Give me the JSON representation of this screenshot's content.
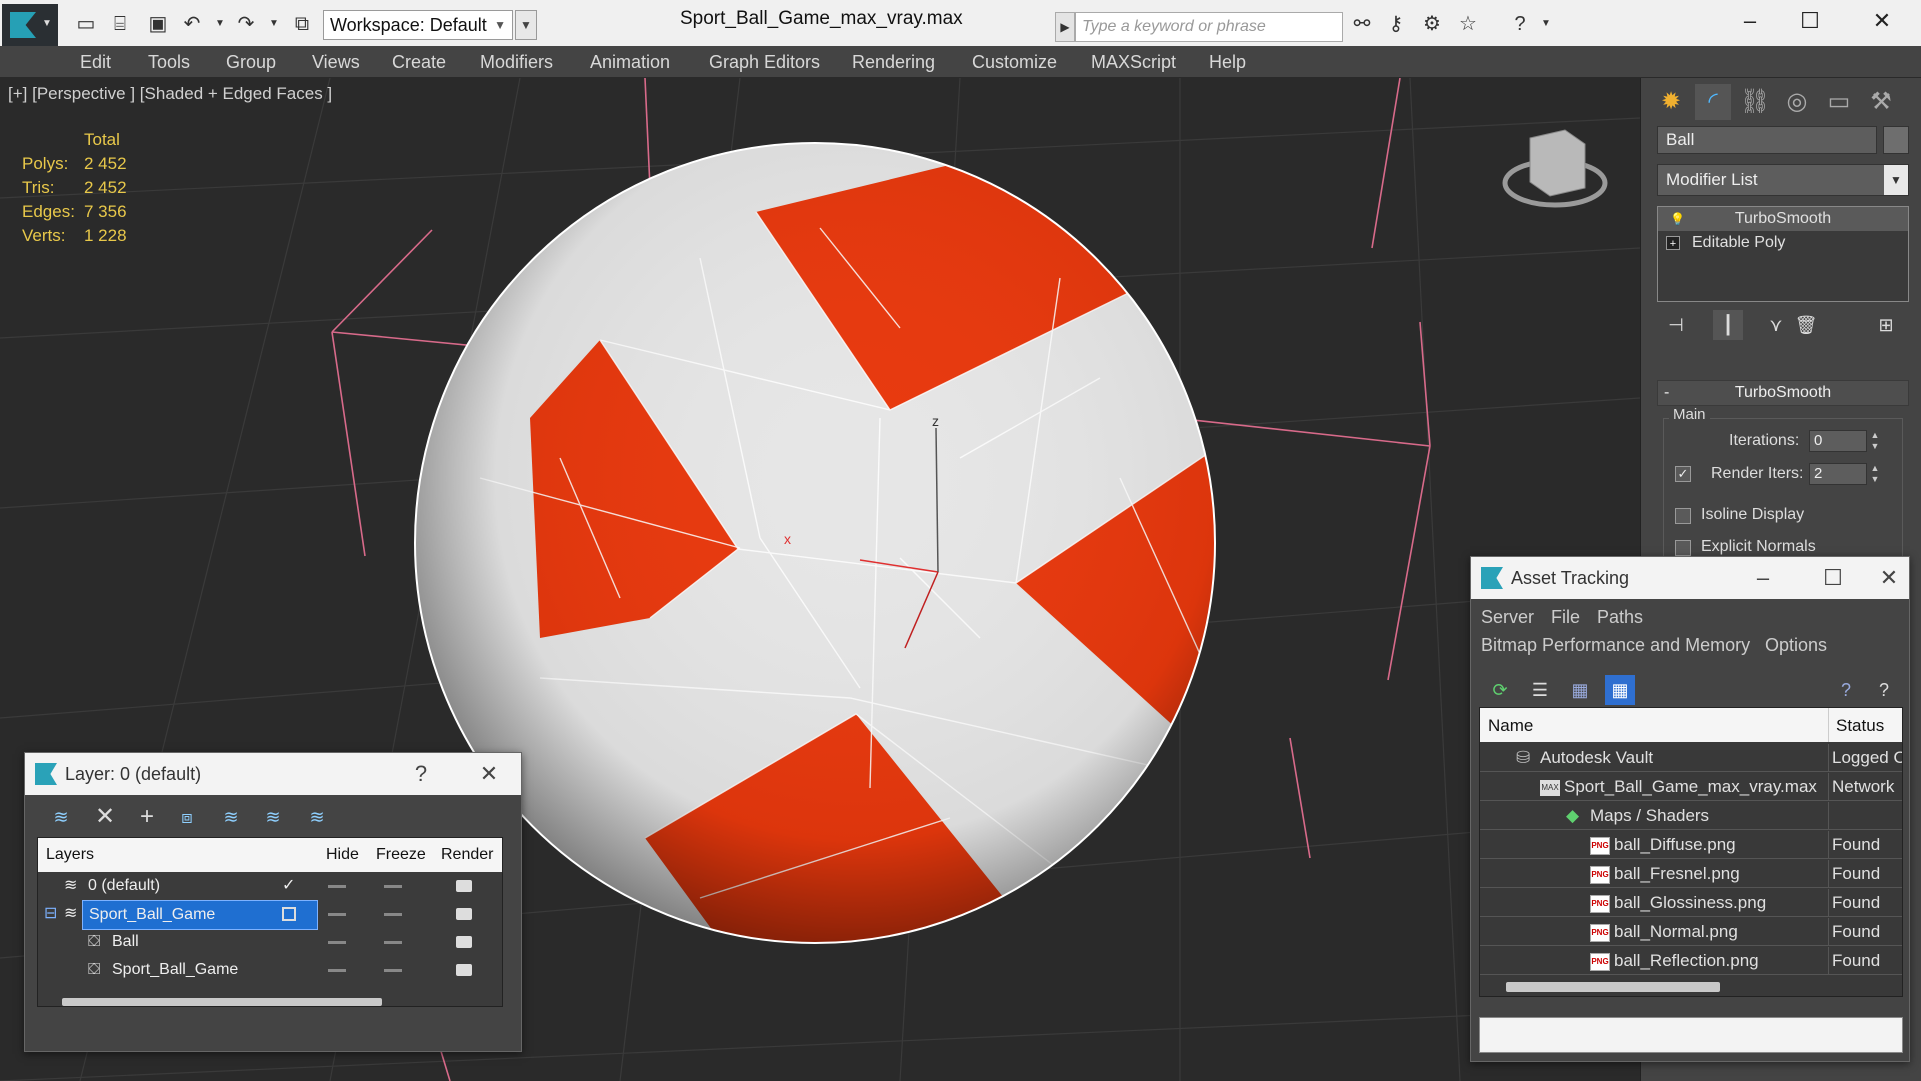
{
  "window": {
    "file_title": "Sport_Ball_Game_max_vray.max",
    "workspace_label": "Workspace: Default",
    "search_placeholder": "Type a keyword or phrase"
  },
  "menu": [
    "Edit",
    "Tools",
    "Group",
    "Views",
    "Create",
    "Modifiers",
    "Animation",
    "Graph Editors",
    "Rendering",
    "Customize",
    "MAXScript",
    "Help"
  ],
  "viewport": {
    "label": "[+] [Perspective ] [Shaded + Edged Faces ]",
    "stats_header": "Total",
    "stats": [
      {
        "label": "Polys:",
        "value": "2 452"
      },
      {
        "label": "Tris:",
        "value": "2 452"
      },
      {
        "label": "Edges:",
        "value": "7 356"
      },
      {
        "label": "Verts:",
        "value": "1 228"
      }
    ],
    "axis_x": "x",
    "axis_z": "z",
    "colors": {
      "ball_red": "#e8380d",
      "ball_white": "#e6e6e6",
      "grid_pink": "#d86a8a"
    }
  },
  "command_panel": {
    "object_name": "Ball",
    "modifier_list": "Modifier List",
    "stack": [
      "TurboSmooth",
      "Editable Poly"
    ],
    "rollout_title": "TurboSmooth",
    "group_main": "Main",
    "iterations_label": "Iterations:",
    "iterations_value": "0",
    "render_iters_label": "Render Iters:",
    "render_iters_value": "2",
    "render_iters_checked": "✓",
    "isoline_label": "Isoline Display",
    "explicit_normals_label": "Explicit Normals"
  },
  "layer_window": {
    "title": "Layer: 0 (default)",
    "help": "?",
    "close": "✕",
    "columns": {
      "layers": "Layers",
      "hide": "Hide",
      "freeze": "Freeze",
      "render": "Render"
    },
    "rows": [
      {
        "name": "0 (default)",
        "check": "✓"
      },
      {
        "name": "Sport_Ball_Game"
      },
      {
        "name": "Ball"
      },
      {
        "name": "Sport_Ball_Game"
      }
    ]
  },
  "asset_window": {
    "title": "Asset Tracking",
    "menu_row1": [
      "Server",
      "File",
      "Paths"
    ],
    "menu_row2": [
      "Bitmap Performance and Memory",
      "Options"
    ],
    "columns": {
      "name": "Name",
      "status": "Status"
    },
    "rows": [
      {
        "name": "Autodesk Vault",
        "status": "Logged O"
      },
      {
        "name": "Sport_Ball_Game_max_vray.max",
        "status": "Network"
      },
      {
        "name": "Maps / Shaders",
        "status": ""
      },
      {
        "name": "ball_Diffuse.png",
        "status": "Found"
      },
      {
        "name": "ball_Fresnel.png",
        "status": "Found"
      },
      {
        "name": "ball_Glossiness.png",
        "status": "Found"
      },
      {
        "name": "ball_Normal.png",
        "status": "Found"
      },
      {
        "name": "ball_Reflection.png",
        "status": "Found"
      }
    ]
  }
}
